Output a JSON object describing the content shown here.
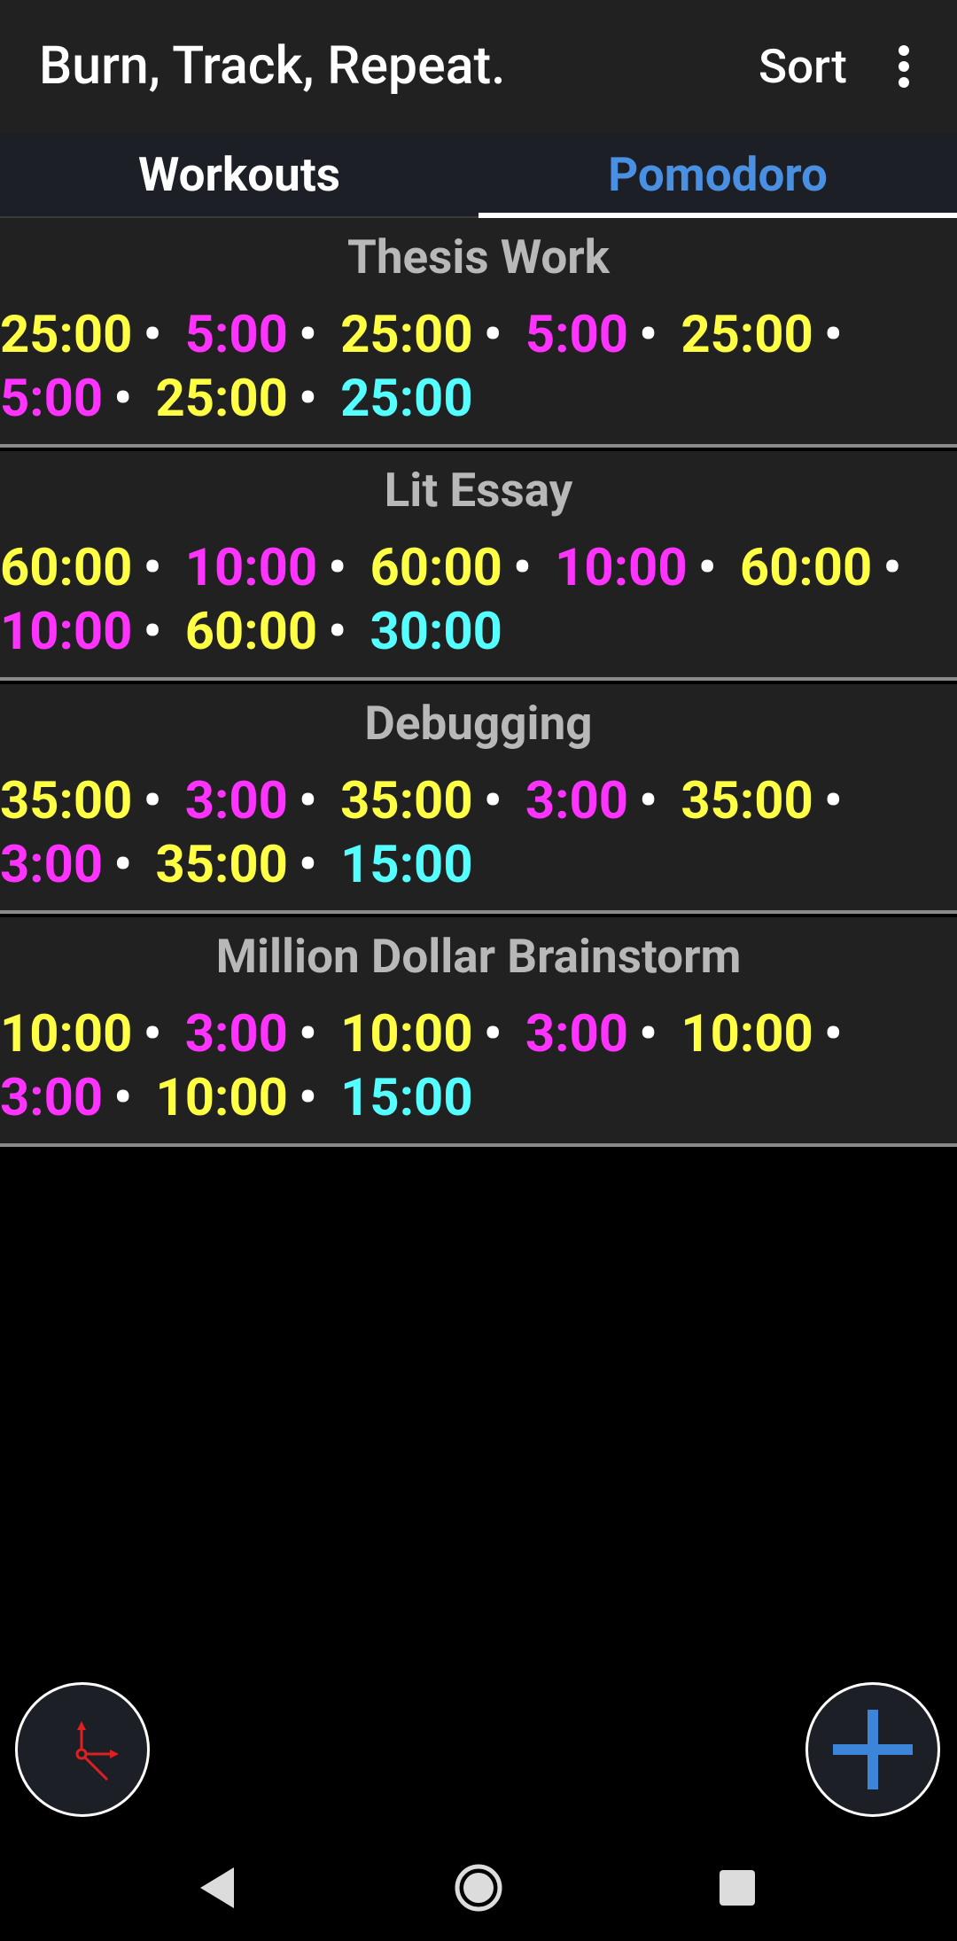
{
  "appbar": {
    "title": "Burn, Track, Repeat.",
    "sort_label": "Sort",
    "overflow_icon": "more-vert-icon"
  },
  "tabs": [
    {
      "label": "Workouts",
      "selected": false
    },
    {
      "label": "Pomodoro",
      "selected": true
    }
  ],
  "colors": {
    "work": "#ffff44",
    "break": "#ff33ff",
    "final": "#55ffff",
    "accent": "#4a90e2",
    "title": "#b8b8b8"
  },
  "sessions": [
    {
      "title": "Thesis Work",
      "intervals": [
        {
          "t": "25:00",
          "kind": "work"
        },
        {
          "t": "5:00",
          "kind": "break"
        },
        {
          "t": "25:00",
          "kind": "work"
        },
        {
          "t": "5:00",
          "kind": "break"
        },
        {
          "t": "25:00",
          "kind": "work"
        },
        {
          "t": "5:00",
          "kind": "break"
        },
        {
          "t": "25:00",
          "kind": "work"
        },
        {
          "t": "25:00",
          "kind": "final"
        }
      ]
    },
    {
      "title": "Lit Essay",
      "intervals": [
        {
          "t": "60:00",
          "kind": "work"
        },
        {
          "t": "10:00",
          "kind": "break"
        },
        {
          "t": "60:00",
          "kind": "work"
        },
        {
          "t": "10:00",
          "kind": "break"
        },
        {
          "t": "60:00",
          "kind": "work"
        },
        {
          "t": "10:00",
          "kind": "break"
        },
        {
          "t": "60:00",
          "kind": "work"
        },
        {
          "t": "30:00",
          "kind": "final"
        }
      ]
    },
    {
      "title": "Debugging",
      "intervals": [
        {
          "t": "35:00",
          "kind": "work"
        },
        {
          "t": "3:00",
          "kind": "break"
        },
        {
          "t": "35:00",
          "kind": "work"
        },
        {
          "t": "3:00",
          "kind": "break"
        },
        {
          "t": "35:00",
          "kind": "work"
        },
        {
          "t": "3:00",
          "kind": "break"
        },
        {
          "t": "35:00",
          "kind": "work"
        },
        {
          "t": "15:00",
          "kind": "final"
        }
      ]
    },
    {
      "title": "Million Dollar Brainstorm",
      "intervals": [
        {
          "t": "10:00",
          "kind": "work"
        },
        {
          "t": "3:00",
          "kind": "break"
        },
        {
          "t": "10:00",
          "kind": "work"
        },
        {
          "t": "3:00",
          "kind": "break"
        },
        {
          "t": "10:00",
          "kind": "work"
        },
        {
          "t": "3:00",
          "kind": "break"
        },
        {
          "t": "10:00",
          "kind": "work"
        },
        {
          "t": "15:00",
          "kind": "final"
        }
      ]
    }
  ],
  "separator": "•",
  "fabs": {
    "left_icon": "clock-icon",
    "right_icon": "add-icon"
  },
  "navbar": {
    "back_icon": "back-triangle-icon",
    "home_icon": "home-circle-icon",
    "recents_icon": "recents-square-icon"
  }
}
